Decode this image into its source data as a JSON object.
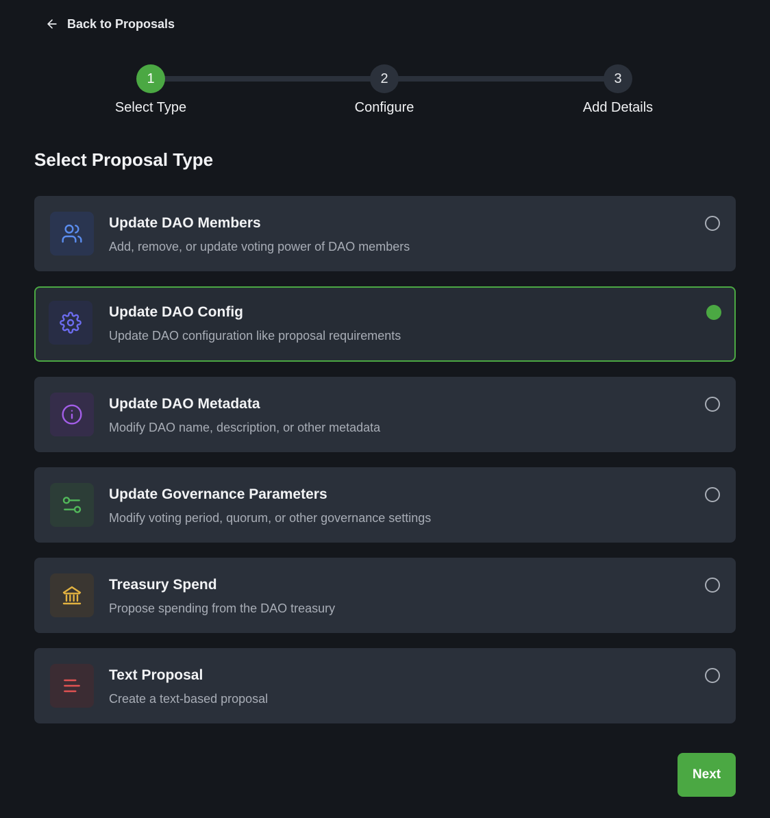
{
  "nav": {
    "back_label": "Back to Proposals"
  },
  "stepper": {
    "steps": [
      {
        "number": "1",
        "label": "Select Type",
        "active": true
      },
      {
        "number": "2",
        "label": "Configure",
        "active": false
      },
      {
        "number": "3",
        "label": "Add Details",
        "active": false
      }
    ]
  },
  "section_title": "Select Proposal Type",
  "proposal_types": [
    {
      "title": "Update DAO Members",
      "description": "Add, remove, or update voting power of DAO members",
      "icon": "users-icon",
      "icon_color": "#5b8def",
      "icon_bg": "#2a3550",
      "selected": false
    },
    {
      "title": "Update DAO Config",
      "description": "Update DAO configuration like proposal requirements",
      "icon": "gear-icon",
      "icon_color": "#6c6cf0",
      "icon_bg": "#282d45",
      "selected": true
    },
    {
      "title": "Update DAO Metadata",
      "description": "Modify DAO name, description, or other metadata",
      "icon": "info-icon",
      "icon_color": "#a35ee8",
      "icon_bg": "#352d4a",
      "selected": false
    },
    {
      "title": "Update Governance Parameters",
      "description": "Modify voting period, quorum, or other governance settings",
      "icon": "sliders-icon",
      "icon_color": "#52b85a",
      "icon_bg": "#2c3d37",
      "selected": false
    },
    {
      "title": "Treasury Spend",
      "description": "Propose spending from the DAO treasury",
      "icon": "bank-icon",
      "icon_color": "#e3b341",
      "icon_bg": "#3a3631",
      "selected": false
    },
    {
      "title": "Text Proposal",
      "description": "Create a text-based proposal",
      "icon": "text-lines-icon",
      "icon_color": "#e05252",
      "icon_bg": "#3b2c33",
      "selected": false
    }
  ],
  "actions": {
    "next_label": "Next"
  },
  "colors": {
    "accent": "#4ba843",
    "background": "#14171c",
    "card": "#2a303a"
  }
}
